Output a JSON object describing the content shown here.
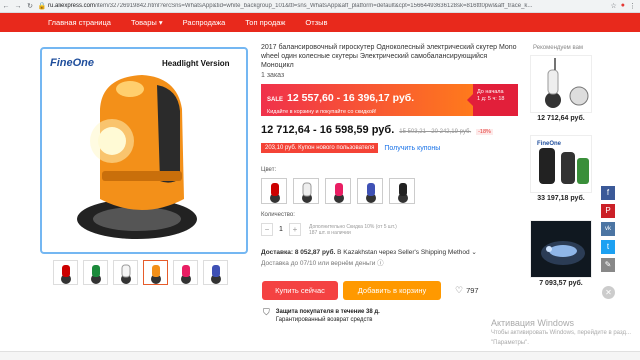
{
  "browser": {
    "url_prefix": "ru.aliexpress.com",
    "url_rest": "/item/32726919842.html?ercSns=WhatsApp&tid=white_backgroup_101&ttl=sns_WhatsApp&aff_platform=default&cpt=15664493636128sk=816ttt0pwl&aff_trace_k..."
  },
  "nav": {
    "items": [
      "Главная страница",
      "Товары",
      "Распродажа",
      "Топ продаж",
      "Отзыв"
    ],
    "dropdown_indicator": "▾"
  },
  "product_image": {
    "brand": "FineOne",
    "caption": "Headlight Version"
  },
  "product": {
    "title": "2017 балансировочный гироскутер Одноколесный электрический скутер Mono wheel один колесные скутеры Электрический самобалансирующийся Моноцикл",
    "orders": "1 заказ",
    "sale_tag": "SALE",
    "sale_price": "12 557,60 - 16 396,17 руб.",
    "sale_sub": "Кидайте в корзину и покупайте со скидкой!",
    "timer_line1": "До начала",
    "timer_line2": "1 д: 5 ч: 18",
    "price": "12 712,64 - 16 598,59 руб.",
    "old_price": "15 503,21 - 20 242,19 руб.",
    "discount": "-18%",
    "coupon": "203,10 руб. Купон нового пользователя",
    "coupon_link": "Получить купоны",
    "color_label": "Цвет:",
    "qty_label": "Количество:",
    "qty_value": "1",
    "qty_minus": "−",
    "qty_plus": "+",
    "qty_note1": "Дополнительно Скидка 10% (от 5 шт.)",
    "qty_note2": "187 шт. в наличии",
    "delivery_label": "Доставка:",
    "delivery_price": "8 052,87 руб.",
    "delivery_rest": "В Kazakhstan через Seller's Shipping Method ⌄",
    "delivery_date": "Доставка до 07/10 или вернём деньги ⓘ",
    "buy_now": "Купить сейчас",
    "add_to_cart": "Добавить в корзину",
    "wishlist_count": "797",
    "protect_line1": "Защита покупателя в течение 38 д.",
    "protect_line2": "Гарантированный возврат средств"
  },
  "recommend": {
    "title": "Рекомендуем вам",
    "items": [
      {
        "price": "12 712,64 руб."
      },
      {
        "price": "33 197,18 руб."
      },
      {
        "price": "7 093,57 руб."
      }
    ]
  },
  "share": {
    "facebook": "f",
    "pinterest": "P",
    "vk": "vk",
    "twitter": "t",
    "edit": "✎",
    "close": "✕"
  },
  "watermark": {
    "title": "Активация Windows",
    "subtitle": "Чтобы активировать Windows, перейдите в разд... \"Параметры\"."
  },
  "colors": {
    "nav_red": "#e8291c",
    "buy_red": "#f44242",
    "cart_orange": "#ff9900",
    "image_border": "#74b7f2"
  }
}
